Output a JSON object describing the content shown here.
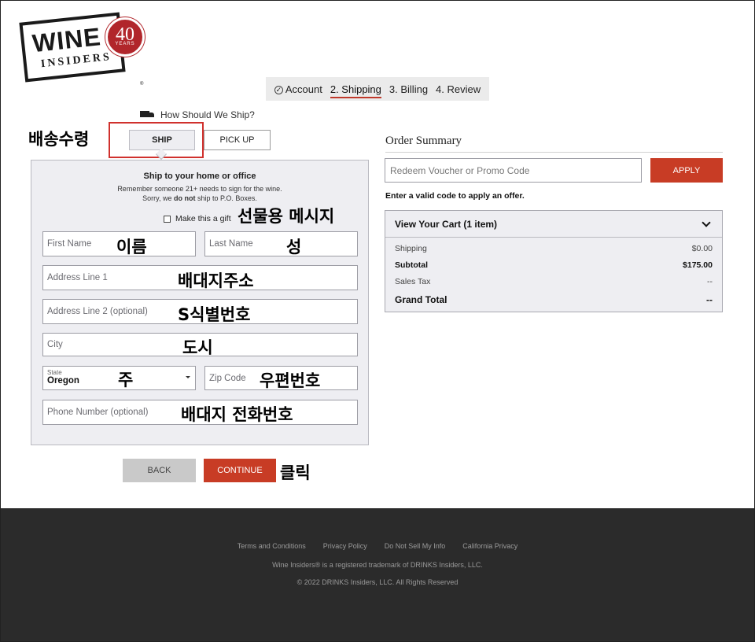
{
  "logo": {
    "wine": "WINE",
    "insiders": "INSIDERS",
    "years_num": "40",
    "years_label": "YEARS",
    "reg": "®"
  },
  "steps": [
    {
      "label": "Account",
      "state": "done"
    },
    {
      "label": "2. Shipping",
      "state": "active"
    },
    {
      "label": "3. Billing",
      "state": "pending"
    },
    {
      "label": "4. Review",
      "state": "pending"
    }
  ],
  "shipping_method": {
    "heading": "How Should We Ship?",
    "ship_label": "SHIP",
    "pickup_label": "PICK UP"
  },
  "form": {
    "title": "Ship to your home or office",
    "notice_1": "Remember someone 21+ needs to sign for the wine.",
    "notice_2_pre": "Sorry, we ",
    "notice_2_bold": "do not",
    "notice_2_post": " ship to P.O. Boxes.",
    "gift_label": "Make this a gift",
    "first_name_placeholder": "First Name",
    "last_name_placeholder": "Last Name",
    "address1_placeholder": "Address Line 1",
    "address2_placeholder": "Address Line 2 (optional)",
    "city_placeholder": "City",
    "state_label": "State",
    "state_value": "Oregon",
    "zip_placeholder": "Zip Code",
    "phone_placeholder": "Phone Number (optional)",
    "back_label": "BACK",
    "continue_label": "CONTINUE"
  },
  "annotations": {
    "method": "배송수령",
    "gift": "선물용 메시지",
    "first_name": "이름",
    "last_name": "성",
    "address1": "배대지주소",
    "address2": "S식별번호",
    "city": "도시",
    "state": "주",
    "zip": "우편번호",
    "phone": "배대지 전화번호",
    "continue": "클릭"
  },
  "order_summary": {
    "title": "Order Summary",
    "promo_placeholder": "Redeem Voucher or Promo Code",
    "apply_label": "APPLY",
    "promo_message": "Enter a valid code to apply an offer.",
    "cart_label": "View Your Cart (1 item)",
    "rows": {
      "shipping": {
        "label": "Shipping",
        "value": "$0.00"
      },
      "subtotal": {
        "label": "Subtotal",
        "value": "$175.00"
      },
      "tax": {
        "label": "Sales Tax",
        "value": "--"
      },
      "grand": {
        "label": "Grand Total",
        "value": "--"
      }
    }
  },
  "footer": {
    "links": [
      "Terms and Conditions",
      "Privacy Policy",
      "Do Not Sell My Info",
      "California Privacy"
    ],
    "trademark": "Wine Insiders® is a registered trademark of DRINKS Insiders, LLC.",
    "copyright": "© 2022 DRINKS Insiders, LLC. All Rights Reserved"
  },
  "colors": {
    "accent": "#c83c25",
    "highlight": "#d0312d",
    "footer_bg": "#2b2b2b"
  }
}
